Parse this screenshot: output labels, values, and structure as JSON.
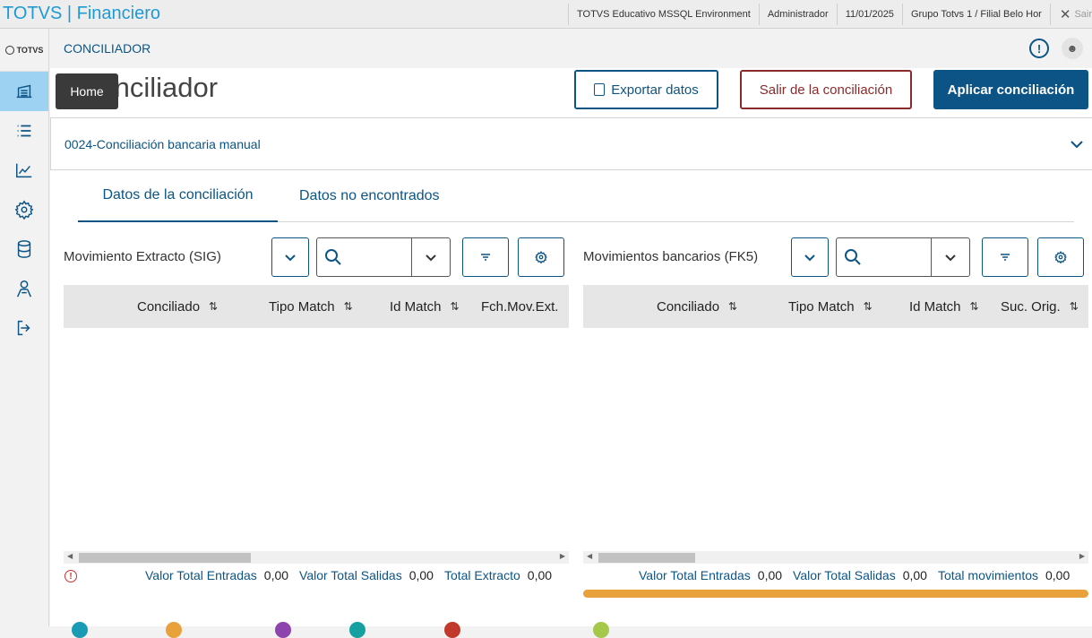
{
  "topbar": {
    "app_title": "TOTVS | Financiero",
    "environment": "TOTVS Educativo MSSQL Environment",
    "user": "Administrador",
    "date": "11/01/2025",
    "branch": "Grupo Totvs 1 / Filial Belo Hor",
    "logout_label": "Sair"
  },
  "sidebar": {
    "logo_text": "TOTVS",
    "tooltip": "Home",
    "items": [
      {
        "icon": "home-icon"
      },
      {
        "icon": "list-icon"
      },
      {
        "icon": "chart-icon"
      },
      {
        "icon": "gear-icon"
      },
      {
        "icon": "database-icon"
      },
      {
        "icon": "user-config-icon"
      },
      {
        "icon": "logout-icon"
      }
    ]
  },
  "header": {
    "module_title": "CONCILIADOR"
  },
  "main": {
    "page_title": "Conciliador",
    "buttons": {
      "export": "Exportar datos",
      "exit": "Salir de la conciliación",
      "apply": "Aplicar conciliación"
    },
    "accordion_label": "0024-Conciliación bancaria manual",
    "tabs": [
      "Datos de la conciliación",
      "Datos no encontrados"
    ],
    "left_panel": {
      "title": "Movimiento Extracto (SIG)",
      "columns": [
        "Conciliado",
        "Tipo Match",
        "Id Match",
        "Fch.Mov.Ext."
      ],
      "totals": [
        {
          "label": "Valor Total Entradas",
          "value": "0,00"
        },
        {
          "label": "Valor Total Salidas",
          "value": "0,00"
        },
        {
          "label": "Total Extracto",
          "value": "0,00"
        }
      ]
    },
    "right_panel": {
      "title": "Movimientos bancarios (FK5)",
      "columns": [
        "Conciliado",
        "Tipo Match",
        "Id Match",
        "Suc. Orig."
      ],
      "totals": [
        {
          "label": "Valor Total Entradas",
          "value": "0,00"
        },
        {
          "label": "Valor Total Salidas",
          "value": "0,00"
        },
        {
          "label": "Total movimientos",
          "value": "0,00"
        }
      ],
      "progress": 1.0
    }
  },
  "colors": {
    "brand": "#1e9ad6",
    "primary": "#0c5485",
    "danger": "#8a2a2a",
    "progress": "#e9a13b",
    "legend_dots": [
      "#1a9bb5",
      "#e9a13b",
      "#8e44ad",
      "#16a0a0",
      "#c0392b",
      "#a6c84a"
    ]
  }
}
